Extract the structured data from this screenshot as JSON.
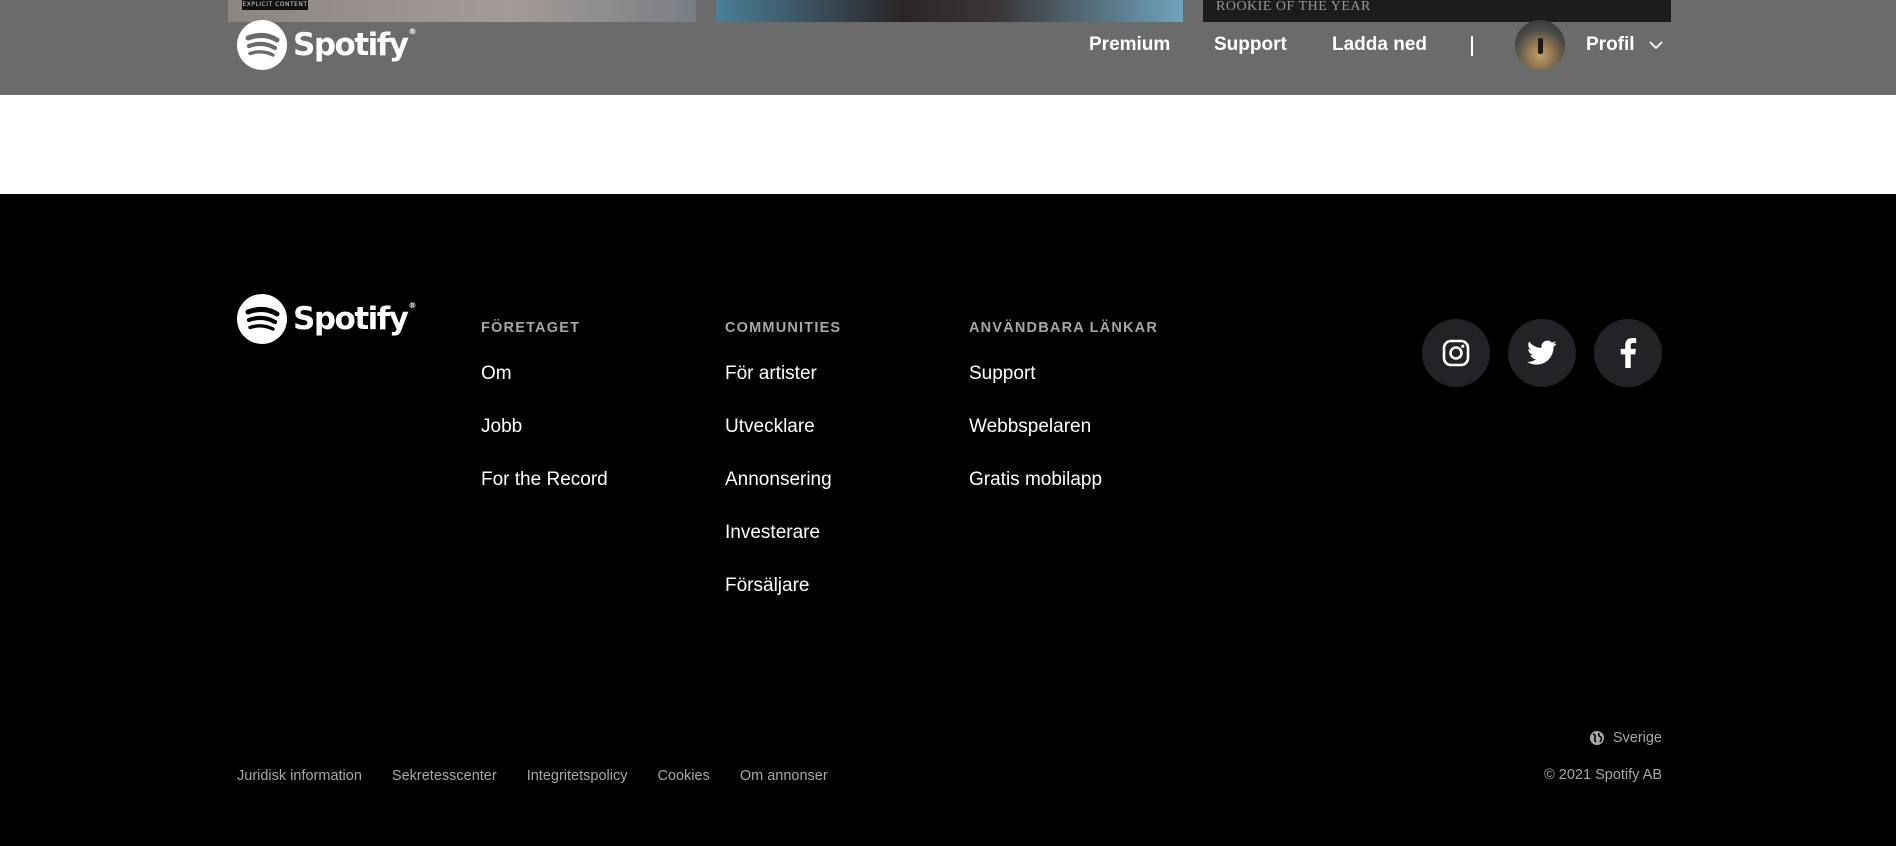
{
  "header": {
    "explicit_badge": "EXPLICIT CONTENT",
    "banner_text": "ROOKIE OF THE YEAR",
    "logo_text": "Spotify",
    "nav": [
      "Premium",
      "Support",
      "Ladda ned"
    ],
    "profile_label": "Profil"
  },
  "footer": {
    "logo_text": "Spotify",
    "columns": [
      {
        "heading": "FÖRETAGET",
        "links": [
          "Om",
          "Jobb",
          "For the Record"
        ]
      },
      {
        "heading": "COMMUNITIES",
        "links": [
          "För artister",
          "Utvecklare",
          "Annonsering",
          "Investerare",
          "Försäljare"
        ]
      },
      {
        "heading": "ANVÄNDBARA LÄNKAR",
        "links": [
          "Support",
          "Webbspelaren",
          "Gratis mobilapp"
        ]
      }
    ],
    "socials": [
      "instagram-icon",
      "twitter-icon",
      "facebook-icon"
    ],
    "legal": [
      "Juridisk information",
      "Sekretesscenter",
      "Integritetspolicy",
      "Cookies",
      "Om annonser"
    ],
    "country": "Sverige",
    "copyright": "© 2021 Spotify AB"
  },
  "colors": {
    "header_bg": "#6b6b6b",
    "footer_bg": "#000000",
    "muted_text": "#a7a7a7",
    "social_bg": "#222326"
  }
}
